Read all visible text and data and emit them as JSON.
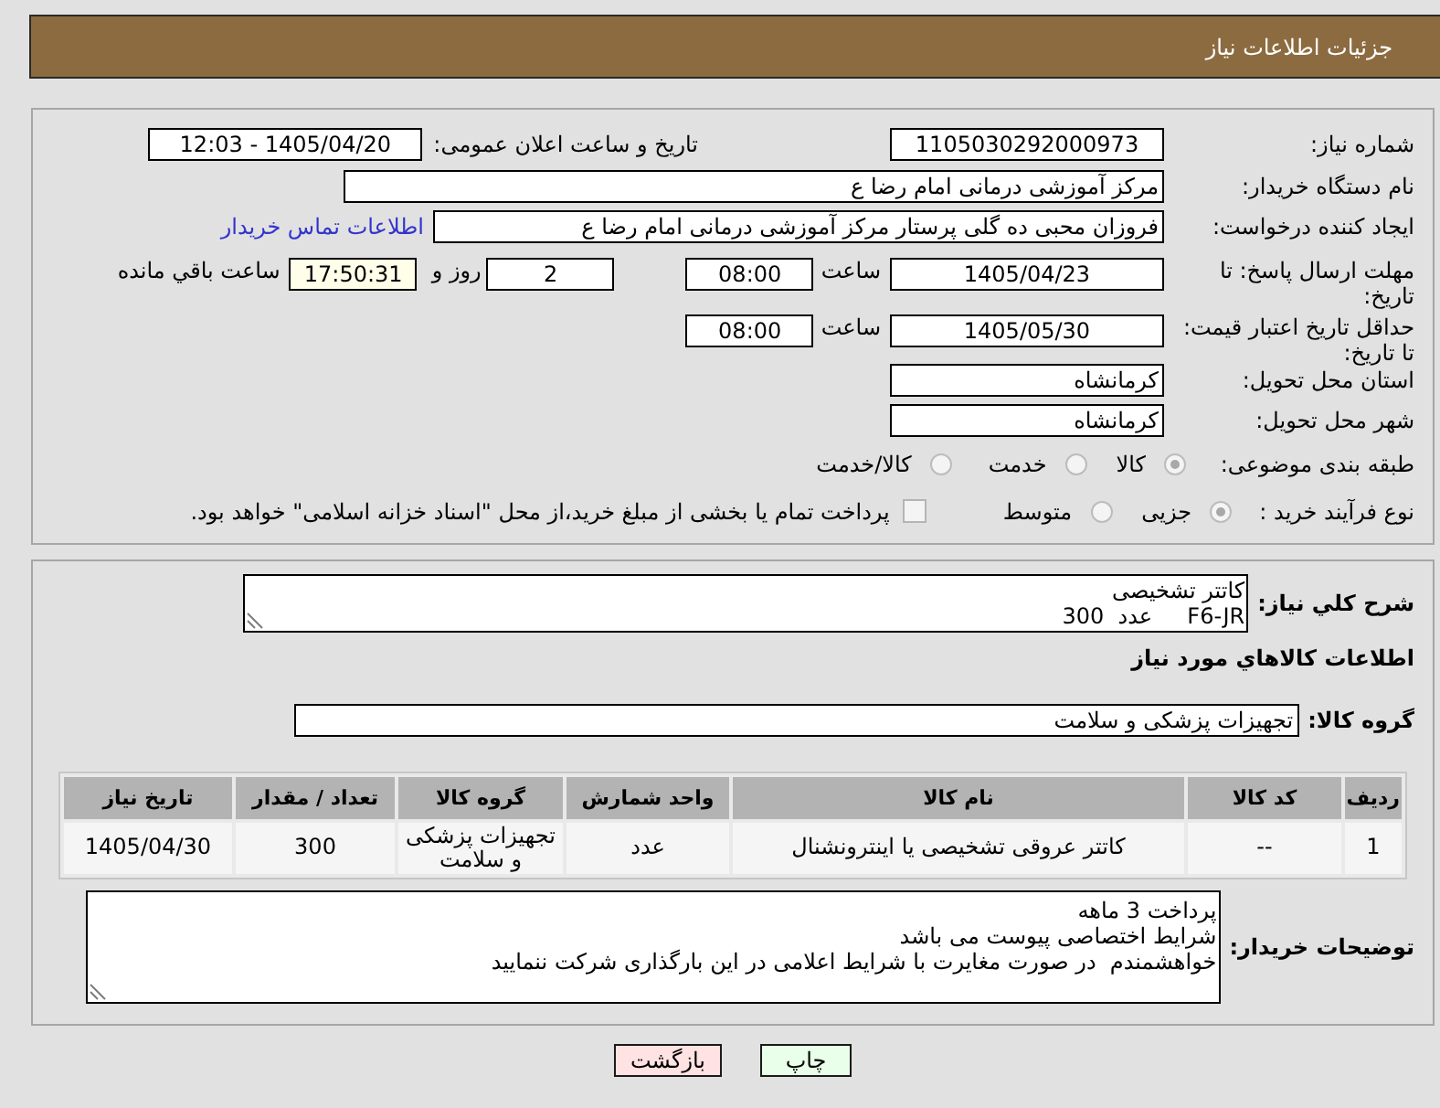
{
  "header": {
    "title": "جزئیات اطلاعات نیاز"
  },
  "request_info": {
    "need_number": {
      "label": "شماره نیاز:",
      "value": "1105030292000973"
    },
    "announcement": {
      "label": "تاریخ و ساعت اعلان عمومی:",
      "value": "1405/04/20 - 12:03"
    },
    "buyer_org": {
      "label": "نام دستگاه خریدار:",
      "value": "مرکز آموزشی  درمانی امام رضا  ع"
    },
    "requester": {
      "label": "ایجاد کننده درخواست:",
      "value": "فروزان محبی ده گلی پرستار مرکز آموزشی  درمانی امام رضا  ع",
      "link": "اطلاعات تماس خریدار"
    },
    "reply_deadline": {
      "label": "مهلت ارسال پاسخ: تا تاریخ:",
      "date": "1405/04/23",
      "time_label": "ساعت",
      "time": "08:00",
      "days": "2",
      "days_label": "روز و",
      "remaining": "17:50:31",
      "remaining_label": "ساعت باقي مانده"
    },
    "price_validity": {
      "label": "حداقل تاریخ اعتبار قیمت: تا تاریخ:",
      "date": "1405/05/30",
      "time_label": "ساعت",
      "time": "08:00"
    },
    "province": {
      "label": "استان محل تحویل:",
      "value": "کرمانشاه"
    },
    "city": {
      "label": "شهر محل تحویل:",
      "value": "کرمانشاه"
    },
    "category": {
      "label": "طبقه بندی موضوعی:",
      "options": [
        {
          "label": "کالا",
          "selected": true
        },
        {
          "label": "خدمت",
          "selected": false
        },
        {
          "label": "کالا/خدمت",
          "selected": false
        }
      ]
    },
    "purchase_type": {
      "label": "نوع فرآیند خرید :",
      "options": [
        {
          "label": "جزیی",
          "selected": true
        },
        {
          "label": "متوسط",
          "selected": false
        }
      ],
      "treasury_payment": {
        "label": "پرداخت تمام یا بخشی از مبلغ خرید،از محل \"اسناد خزانه اسلامی\" خواهد بود.",
        "checked": false
      }
    }
  },
  "need_summary": {
    "description": {
      "label": "شرح کلي نیاز:",
      "value": "کاتتر تشخیصی\nF6-JR     عدد  300"
    },
    "items_title": "اطلاعات كالاهاي مورد نياز",
    "goods_group": {
      "label": "گروه کالا:",
      "value": "تجهیزات پزشکی و سلامت"
    },
    "table": {
      "columns": [
        "ردیف",
        "کد کالا",
        "نام کالا",
        "واحد شمارش",
        "گروه کالا",
        "تعداد / مقدار",
        "تاریخ نیاز"
      ],
      "rows": [
        [
          "1",
          "--",
          "کاتتر عروقی تشخیصی یا اینترونشنال",
          "عدد",
          "تجهیزات پزشکی و سلامت",
          "300",
          "1405/04/30"
        ]
      ]
    },
    "buyer_notes": {
      "label": "توضیحات خریدار:",
      "value": "پرداخت 3 ماهه\nشرایط اختصاصی پیوست می باشد\nخواهشمندم  در صورت مغایرت با شرایط اعلامی در این بارگذاری شرکت ننمایید"
    }
  },
  "buttons": [
    {
      "kind": "print",
      "label": "چاپ"
    },
    {
      "kind": "back",
      "label": "بازگشت"
    }
  ]
}
